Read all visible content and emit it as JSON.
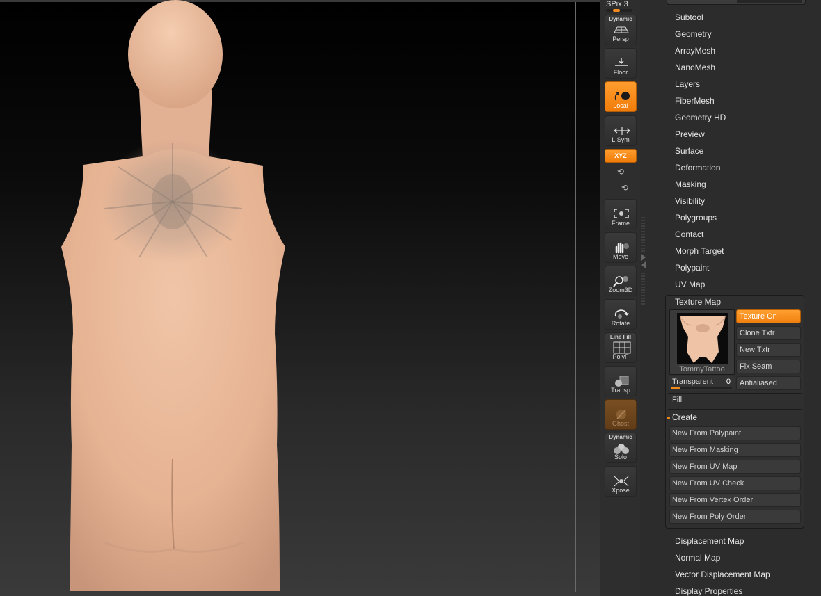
{
  "shelf": {
    "spix_label": "SPix 3",
    "persp": {
      "top": "Dynamic",
      "label": "Persp"
    },
    "floor": {
      "label": "Floor"
    },
    "local": {
      "label": "Local"
    },
    "lsym": {
      "label": "L.Sym"
    },
    "xyz": {
      "label": "XYZ"
    },
    "frame": {
      "label": "Frame"
    },
    "move": {
      "label": "Move"
    },
    "zoom3d": {
      "label": "Zoom3D"
    },
    "rotate": {
      "label": "Rotate"
    },
    "polyf": {
      "top": "Line Fill",
      "label": "PolyF"
    },
    "transp": {
      "label": "Transp"
    },
    "ghost": {
      "label": "Ghost"
    },
    "solo": {
      "top": "Dynamic",
      "label": "Solo"
    },
    "xpose": {
      "label": "Xpose"
    }
  },
  "menu": {
    "items": [
      "Subtool",
      "Geometry",
      "ArrayMesh",
      "NanoMesh",
      "Layers",
      "FiberMesh",
      "Geometry HD",
      "Preview",
      "Surface",
      "Deformation",
      "Masking",
      "Visibility",
      "Polygroups",
      "Contact",
      "Morph Target",
      "Polypaint",
      "UV Map"
    ],
    "after": [
      "Displacement Map",
      "Normal Map",
      "Vector Displacement Map",
      "Display Properties"
    ]
  },
  "texture_map": {
    "title": "Texture Map",
    "thumb_name": "TommyTattoo",
    "buttons": [
      "Texture On",
      "Clone Txtr",
      "New Txtr",
      "Fix Seam",
      "Antialiased"
    ],
    "transparent_label": "Transparent",
    "transparent_value": "0",
    "transparent_level": 0.05,
    "fill_label": "Fill",
    "create_label": "Create",
    "create_buttons": [
      "New From Polypaint",
      "New From Masking",
      "New From UV Map",
      "New From UV Check",
      "New From Vertex Order",
      "New From Poly Order"
    ]
  },
  "colors": {
    "accent": "#f08a1c",
    "skin": "#e9b99a",
    "panel_bg": "#2c2c2c"
  }
}
